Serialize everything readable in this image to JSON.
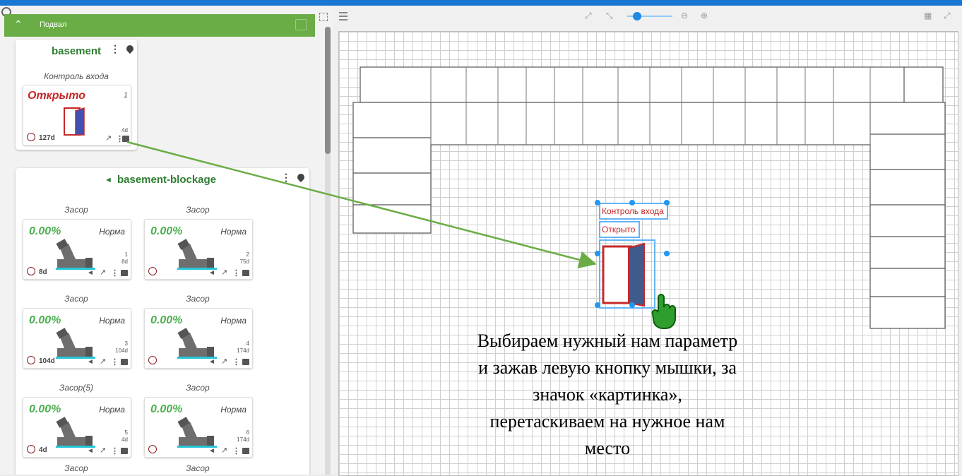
{
  "group": {
    "title": "Подвал"
  },
  "card1": {
    "title": "basement",
    "widget_label": "Контроль входа",
    "tile": {
      "value": "Открыто",
      "id": "1",
      "age": "127d",
      "pic_age": "4d"
    }
  },
  "card2": {
    "title": "basement-blockage",
    "widgets": [
      {
        "label": "Засор",
        "value": "0.00%",
        "status": "Норма",
        "id": "1",
        "pic_age": "8d",
        "age": "8d"
      },
      {
        "label": "Засор",
        "value": "0.00%",
        "status": "Норма",
        "id": "2",
        "pic_age": "75d",
        "age": ""
      },
      {
        "label": "Засор",
        "value": "0.00%",
        "status": "Норма",
        "id": "3",
        "pic_age": "104d",
        "age": "104d"
      },
      {
        "label": "Засор",
        "value": "0.00%",
        "status": "Норма",
        "id": "4",
        "pic_age": "174d",
        "age": ""
      },
      {
        "label": "Засор(5)",
        "value": "0.00%",
        "status": "Норма",
        "id": "5",
        "pic_age": "4d",
        "age": "4d"
      },
      {
        "label": "Засор",
        "value": "0.00%",
        "status": "Норма",
        "id": "6",
        "pic_age": "174d",
        "age": ""
      }
    ],
    "next_labels": [
      "Засор",
      "Засор"
    ]
  },
  "canvas_widget": {
    "label": "Контроль входа",
    "value": "Открыто"
  },
  "caption": {
    "line1": "Выбираем нужный нам параметр",
    "line2": "и зажав левую кнопку мышки, за",
    "line3": "значок «картинка»,",
    "line4": "перетаскиваем на нужное нам",
    "line5": "место"
  },
  "colors": {
    "accent": "#6aad46",
    "title_green": "#2e7d32",
    "value_green": "#4caf50",
    "open_red": "#c62828",
    "highlight_blue": "#64b5f6"
  },
  "icons": [
    "search-icon",
    "chevron-up-icon",
    "menu-icon",
    "fit-icon",
    "fullscreen-icon",
    "zoom-out-icon",
    "zoom-in-icon",
    "layout-icon",
    "kebab-icon",
    "pin-icon",
    "alarm-icon",
    "chart-icon",
    "image-icon",
    "megaphone-icon",
    "hand-cursor-icon"
  ]
}
